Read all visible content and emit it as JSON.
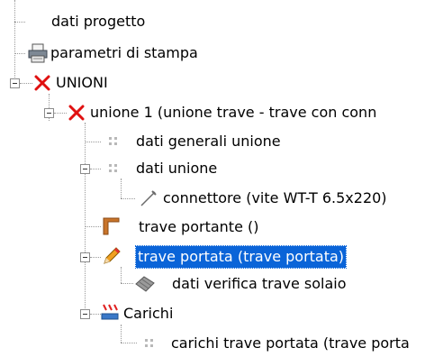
{
  "tree": {
    "items": [
      {
        "label": "dati progetto",
        "icon": "blank"
      },
      {
        "label": "parametri di stampa",
        "icon": "printer-icon"
      },
      {
        "label": "UNIONI",
        "icon": "red-x-icon"
      },
      {
        "label": "unione 1 (unione trave - trave con conn",
        "icon": "red-x-icon"
      },
      {
        "label": "dati generali unione",
        "icon": "grid-dots-icon"
      },
      {
        "label": "dati unione",
        "icon": "grid-dots-icon"
      },
      {
        "label": "connettore (vite WT-T 6.5x220)",
        "icon": "screw-icon"
      },
      {
        "label": "trave portante ()",
        "icon": "beam-icon"
      },
      {
        "label": "trave portata (trave portata)",
        "icon": "pencil-icon",
        "selected": true
      },
      {
        "label": "dati verifica trave solaio",
        "icon": "hatched-plate-icon"
      },
      {
        "label": "Carichi",
        "icon": "loads-icon"
      },
      {
        "label": "carichi trave portata (trave porta",
        "icon": "grid-dots-icon"
      }
    ]
  },
  "colors": {
    "selection": "#0a64d8",
    "red_x": "#e01010",
    "beam": "#c8742a"
  }
}
